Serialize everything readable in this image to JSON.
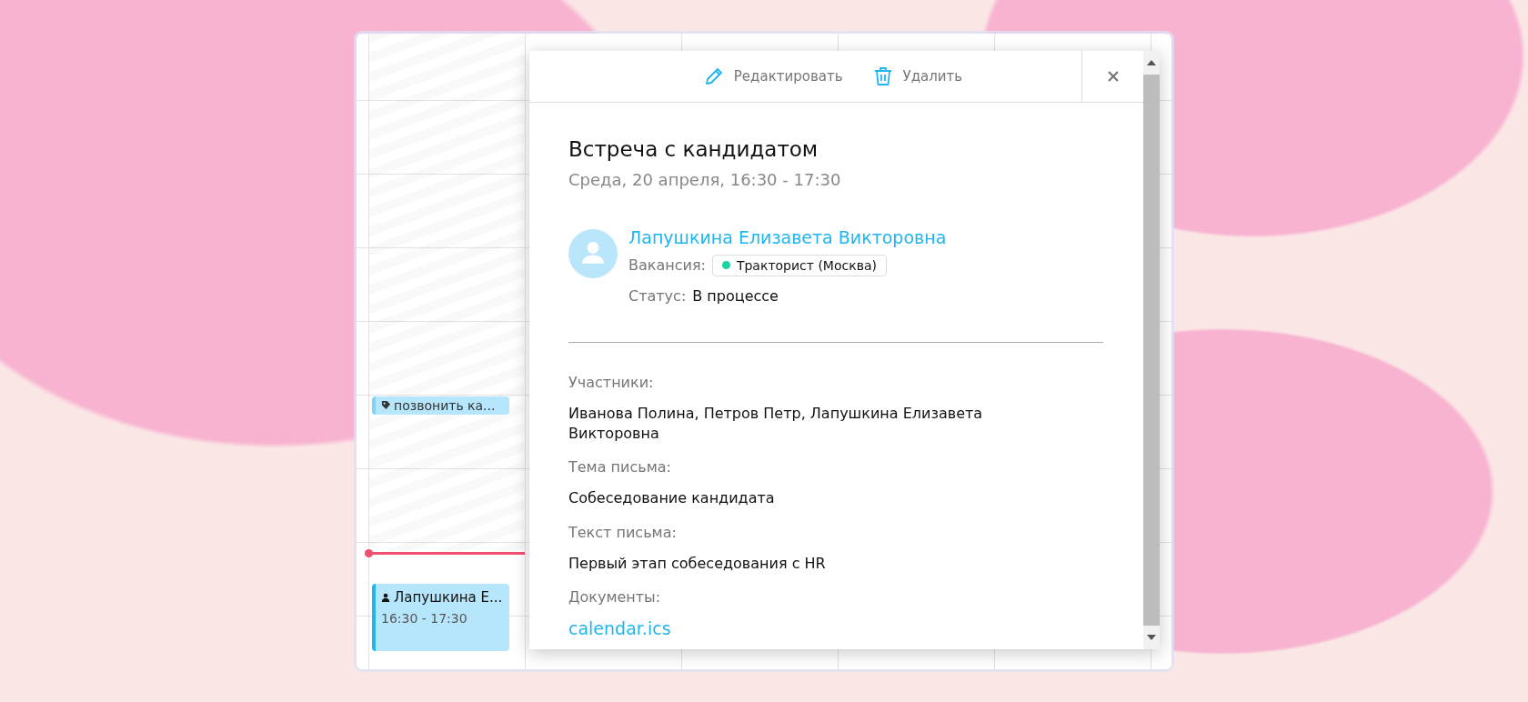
{
  "calendar": {
    "events": [
      {
        "kind": "task",
        "title": "позвонить ка..."
      },
      {
        "kind": "meeting",
        "title": "Лапушкина Е...",
        "time": "16:30 - 17:30"
      }
    ]
  },
  "popup": {
    "actions": [
      {
        "kind": "edit",
        "label": "Редактировать"
      },
      {
        "kind": "delete",
        "label": "Удалить"
      }
    ],
    "title": "Встреча с кандидатом",
    "datetime": "Среда, 20 апреля, 16:30 - 17:30",
    "candidate": {
      "name": "Лапушкина Елизавета Викторовна",
      "vacancy_label": "Вакансия:",
      "vacancy": {
        "name": "Тракторист (Москва)",
        "color": "#1ed3a0"
      },
      "status_label": "Статус:",
      "status": "В процессе"
    },
    "fields": [
      {
        "kind": "text",
        "label": "Участники:",
        "value": "Иванова Полина, Петров Петр, Лапушкина Елизавета Викторовна"
      },
      {
        "kind": "text",
        "label": "Тема письма:",
        "value": "Собеседование кандидата"
      },
      {
        "kind": "text",
        "label": "Текст письма:",
        "value": "Первый этап собеседования с HR"
      },
      {
        "kind": "link",
        "label": "Документы:",
        "value": "calendar.ics"
      }
    ]
  }
}
